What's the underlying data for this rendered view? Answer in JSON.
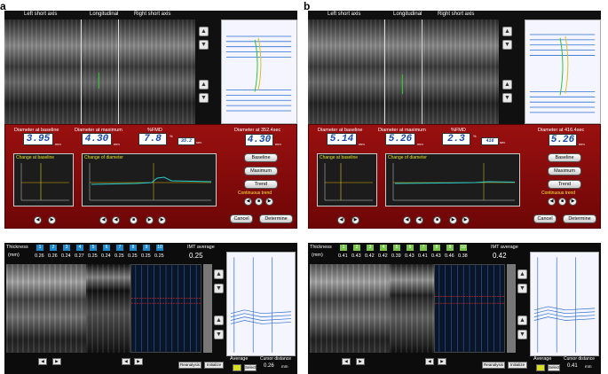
{
  "panels": [
    {
      "label": "a",
      "view_labels": [
        "Left short axis",
        "Longitudinal",
        "Right short axis"
      ],
      "diameter_baseline_label": "Diameter at baseline",
      "diameter_baseline": "3.95",
      "diameter_maximum_label": "Diameter at maximum",
      "diameter_maximum": "4.30",
      "fmd_label": "%FMD",
      "fmd": "7.8",
      "fmd_small": "35.2",
      "diameter_live_label": "Diameter at 352.4sec",
      "diameter_live": "4.30",
      "unit_mm": "mm",
      "unit_pct": "%",
      "unit_sec": "sec",
      "change_baseline_title": "Change at baseline",
      "change_diameter_title": "Change of diameter",
      "btn_baseline": "Baseline",
      "btn_maximum": "Maximum",
      "btn_trend": "Trend",
      "continuous_trend": "Continuous trend",
      "btn_cancel": "Cancel",
      "btn_determine": "Determine",
      "thickness_label": "Thickness",
      "thickness_unit": "(mm)",
      "imt_average_label": "IMT average",
      "imt_average": "0.25",
      "thickness_values": [
        "0.26",
        "0.26",
        "0.24",
        "0.27",
        "0.25",
        "0.24",
        "0.25",
        "0.25",
        "0.25",
        "0.25"
      ],
      "btn_reanalysis": "Reanalysis",
      "btn_initialize": "Initialize",
      "average_label": "Average",
      "select_label": "Select",
      "cursor_distance_label": "Cursor distance",
      "cursor_distance": "0.26",
      "cursor_unit": "mm",
      "thickness_color": "#1e88c9"
    },
    {
      "label": "b",
      "view_labels": [
        "Left short axis",
        "Longitudinal",
        "Right short axis"
      ],
      "diameter_baseline_label": "Diameter at baseline",
      "diameter_baseline": "5.14",
      "diameter_maximum_label": "Diameter at maximum",
      "diameter_maximum": "5.26",
      "fmd_label": "%FMD",
      "fmd": "2.3",
      "fmd_small": "416",
      "diameter_live_label": "Diameter at 416.4sec",
      "diameter_live": "5.26",
      "unit_mm": "mm",
      "unit_pct": "%",
      "unit_sec": "sec",
      "change_baseline_title": "Change at baseline",
      "change_diameter_title": "Change of diameter",
      "btn_baseline": "Baseline",
      "btn_maximum": "Maximum",
      "btn_trend": "Trend",
      "continuous_trend": "Continuous trend",
      "btn_cancel": "Cancel",
      "btn_determine": "Determine",
      "thickness_label": "Thickness",
      "thickness_unit": "(mm)",
      "imt_average_label": "IMT average",
      "imt_average": "0.42",
      "thickness_values": [
        "0.41",
        "0.43",
        "0.42",
        "0.42",
        "0.39",
        "0.43",
        "0.41",
        "0.43",
        "0.46",
        "0.38"
      ],
      "btn_reanalysis": "Reanalysis",
      "btn_initialize": "Initialize",
      "average_label": "Average",
      "select_label": "Select",
      "cursor_distance_label": "Cursor distance",
      "cursor_distance": "0.41",
      "cursor_unit": "mm",
      "thickness_color": "#7bc44c"
    }
  ],
  "colors": {
    "red_panel": "#8b0d0d",
    "trace_line": "#2a6fd1",
    "accent_green": "#2ec22e",
    "value_blue": "#1a4aa8"
  }
}
